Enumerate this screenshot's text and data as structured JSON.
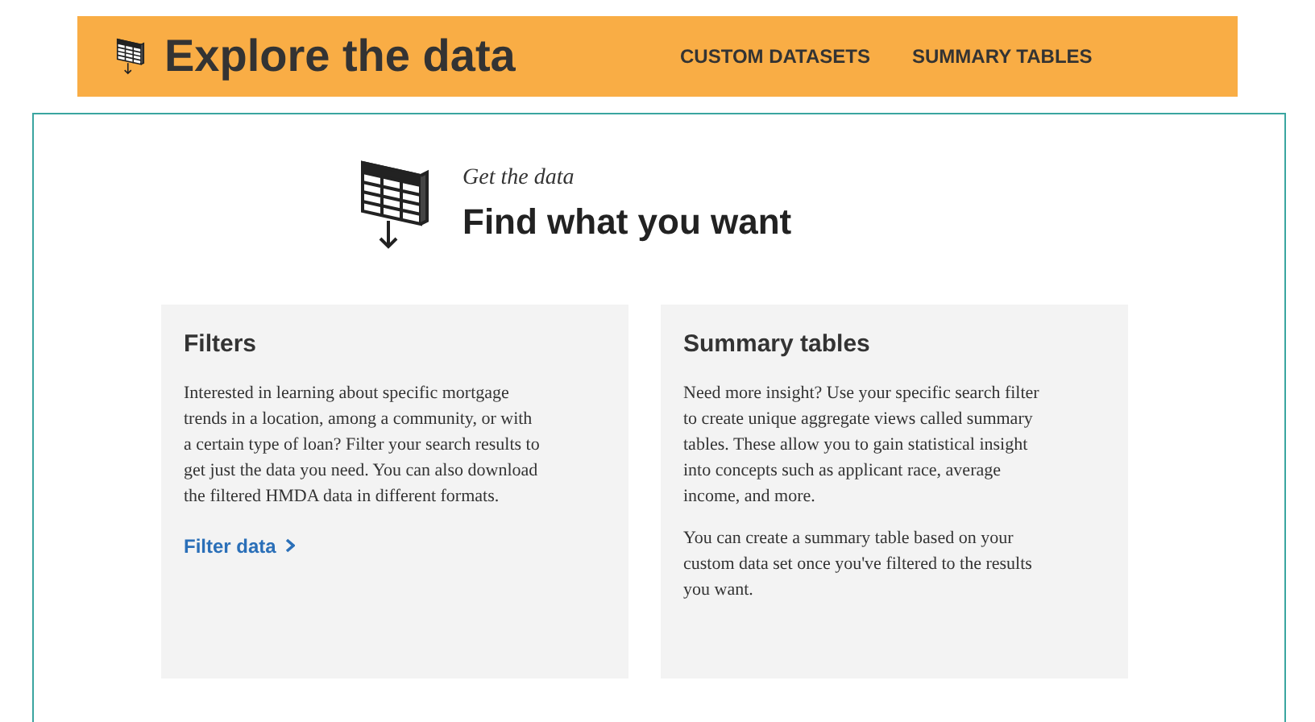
{
  "header": {
    "title": "Explore the data",
    "nav": [
      "CUSTOM DATASETS",
      "SUMMARY TABLES"
    ]
  },
  "intro": {
    "eyebrow": "Get the data",
    "heading": "Find what you want"
  },
  "cards": [
    {
      "title": "Filters",
      "paragraphs": [
        "Interested in learning about specific mortgage trends in a location, among a community, or with a certain type of loan? Filter your search results to get just the data you need. You can also download the filtered HMDA data in different formats."
      ],
      "link": "Filter data"
    },
    {
      "title": "Summary tables",
      "paragraphs": [
        "Need more insight? Use your specific search filter to create unique aggregate views called summary tables. These allow you to gain statistical insight into concepts such as applicant race, average income, and more.",
        "You can create a summary table based on your custom data set once you've filtered to the results you want."
      ]
    }
  ]
}
